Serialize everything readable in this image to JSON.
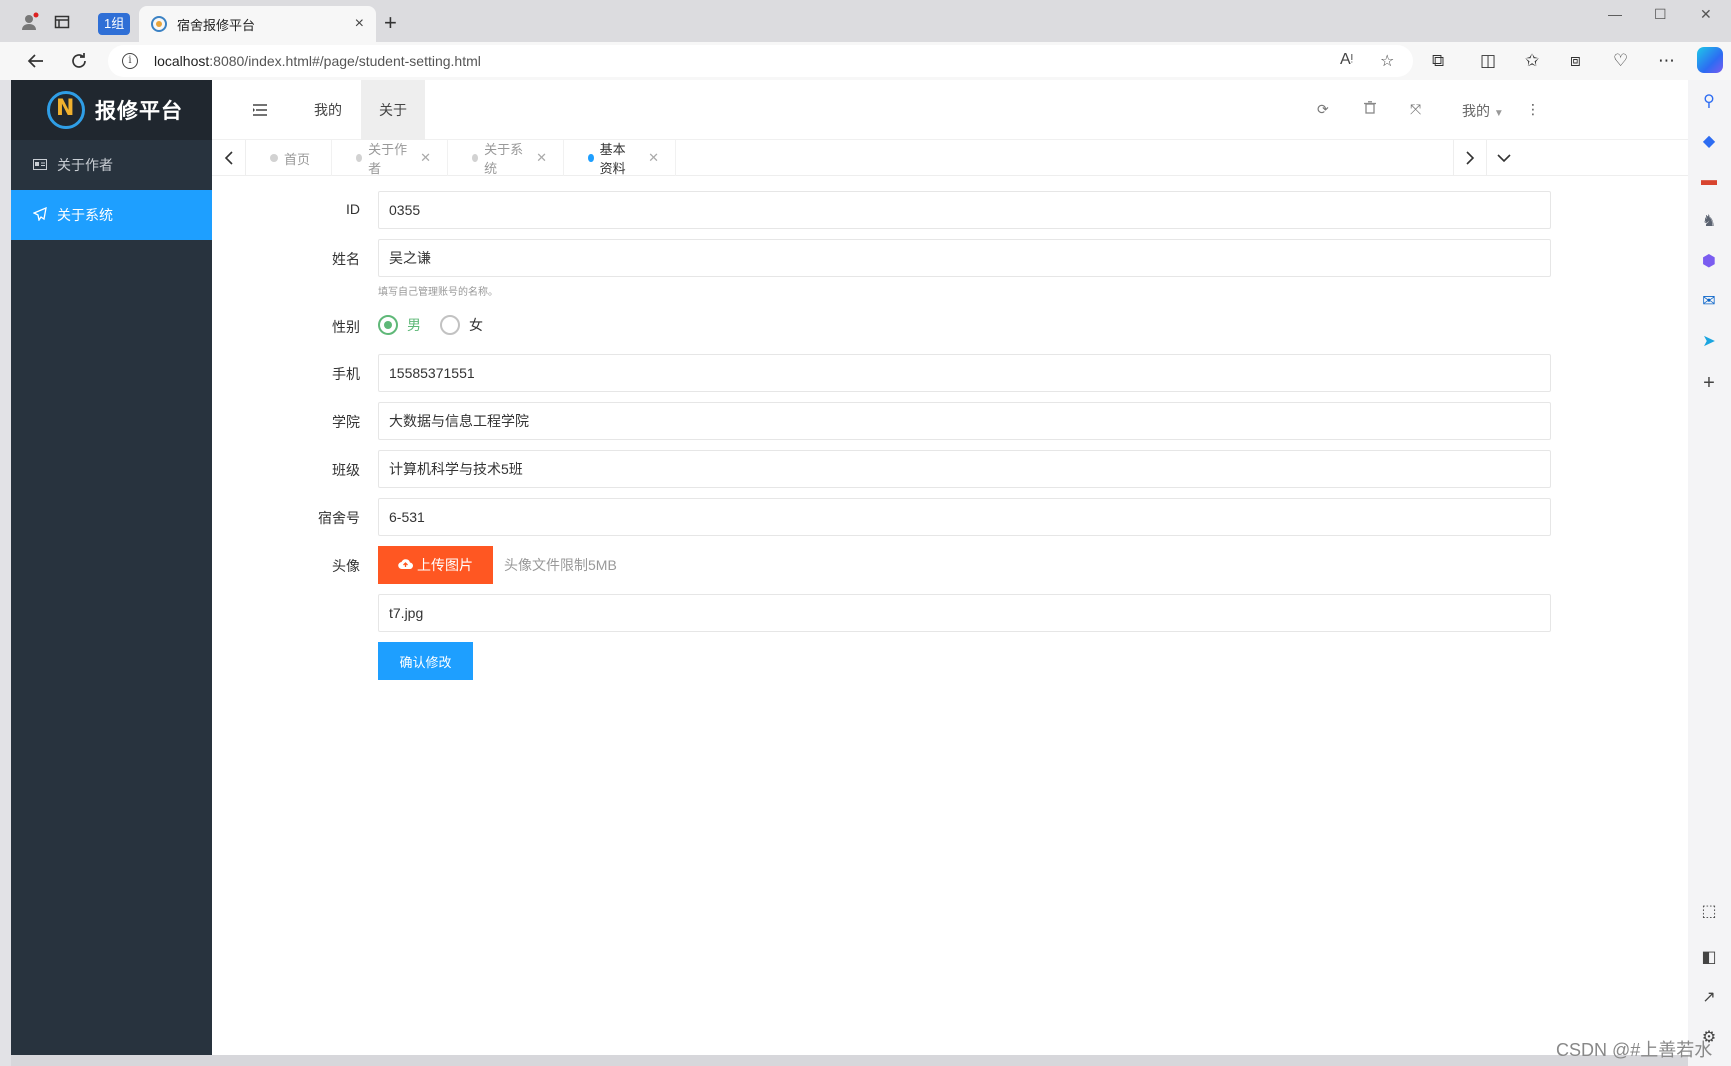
{
  "browser": {
    "group_badge": "1组",
    "tab_title": "宿舍报修平台",
    "tab_close": "×",
    "new_tab": "+",
    "url_host": "localhost",
    "url_rest": ":8080/index.html#/page/student-setting.html",
    "win_min": "—",
    "win_max": "☐",
    "win_close": "✕"
  },
  "sidebar": {
    "logo_text": "报修平台",
    "items": [
      {
        "label": "关于作者",
        "icon": "id-card-icon",
        "active": false
      },
      {
        "label": "关于系统",
        "icon": "paper-plane-icon",
        "active": true
      }
    ]
  },
  "header": {
    "menu_items": [
      {
        "label": "我的",
        "active": false
      },
      {
        "label": "关于",
        "active": true
      }
    ],
    "user_menu": "我的"
  },
  "tabs": [
    {
      "label": "首页",
      "closable": false,
      "active": false
    },
    {
      "label": "关于作者",
      "closable": true,
      "active": false
    },
    {
      "label": "关于系统",
      "closable": true,
      "active": false
    },
    {
      "label": "基本资料",
      "closable": true,
      "active": true
    }
  ],
  "form": {
    "id": {
      "label": "ID",
      "value": "0355"
    },
    "name": {
      "label": "姓名",
      "value": "吴之谦",
      "hint": "填写自己管理账号的名称。"
    },
    "gender": {
      "label": "性别",
      "options": [
        "男",
        "女"
      ],
      "selected": "男"
    },
    "phone": {
      "label": "手机",
      "value": "15585371551"
    },
    "college": {
      "label": "学院",
      "value": "大数据与信息工程学院"
    },
    "class": {
      "label": "班级",
      "value": "计算机科学与技术5班"
    },
    "dorm": {
      "label": "宿舍号",
      "value": "6-531"
    },
    "avatar": {
      "label": "头像",
      "upload_label": "上传图片",
      "note": "头像文件限制5MB",
      "file_value": "t7.jpg"
    },
    "submit_label": "确认修改"
  },
  "watermark": "CSDN @#上善若水",
  "colors": {
    "sidebar_bg": "#28333e",
    "accent_blue": "#1e9fff",
    "upload_orange": "#ff5722",
    "radio_green": "#5fb878"
  }
}
